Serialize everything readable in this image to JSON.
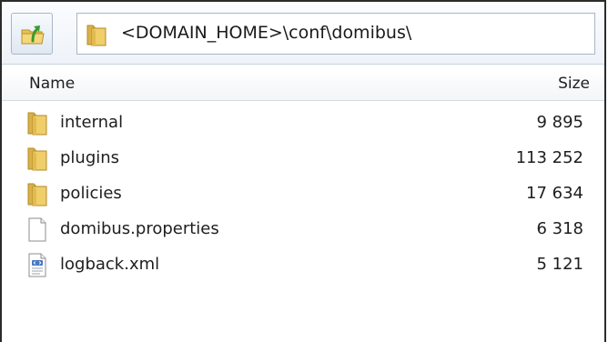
{
  "address_bar": {
    "path": "<DOMAIN_HOME>\\conf\\domibus\\",
    "up_icon": "folder-up-arrow-icon",
    "path_icon": "folder-icon"
  },
  "columns": {
    "name": "Name",
    "size": "Size"
  },
  "files": [
    {
      "name": "internal",
      "size": "9 895",
      "icon": "folder-icon"
    },
    {
      "name": "plugins",
      "size": "113 252",
      "icon": "folder-icon"
    },
    {
      "name": "policies",
      "size": "17 634",
      "icon": "folder-icon"
    },
    {
      "name": "domibus.properties",
      "size": "6 318",
      "icon": "file-icon"
    },
    {
      "name": "logback.xml",
      "size": "5 121",
      "icon": "xml-file-icon"
    }
  ],
  "colors": {
    "folder": "#e8c35a",
    "up_arrow": "#3a9a2c",
    "border": "#a9b6c6"
  }
}
